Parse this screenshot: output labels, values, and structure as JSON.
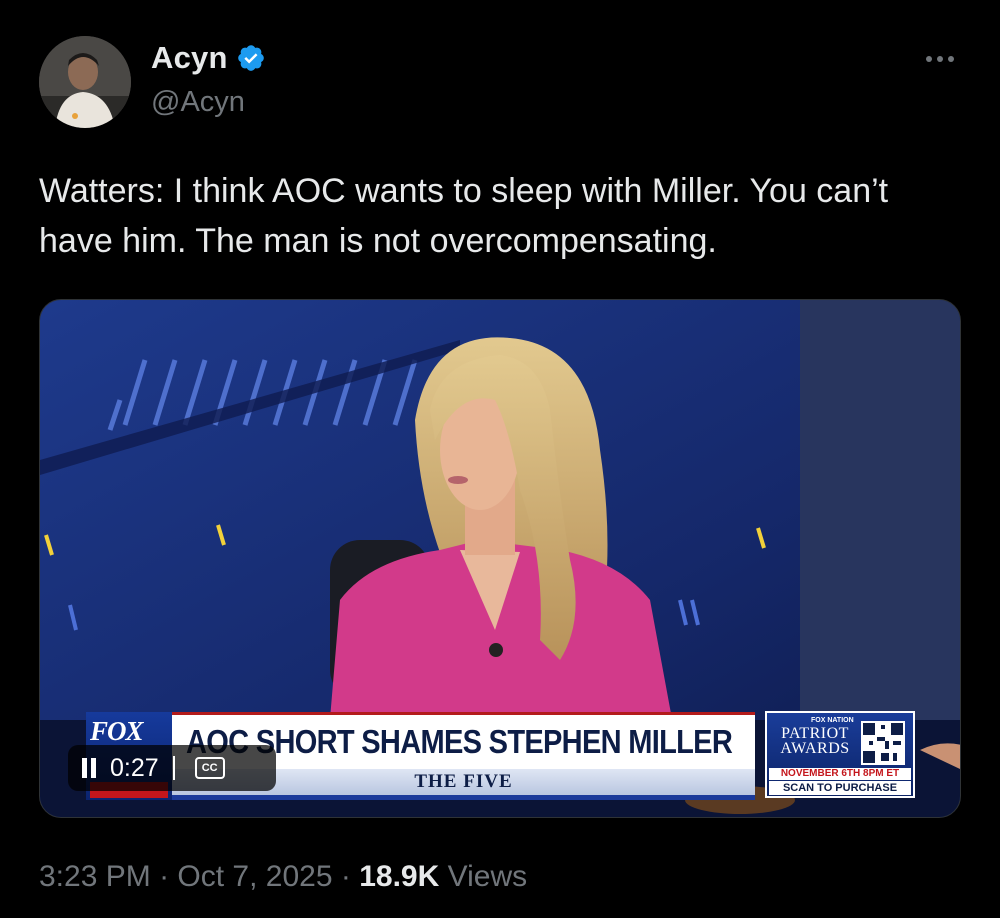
{
  "author": {
    "display_name": "Acyn",
    "handle": "@Acyn",
    "verified": true,
    "verified_badge_color": "#1d9bf0"
  },
  "tweet": {
    "text": "Watters: I think AOC wants to sleep with Miller. You can’t have him. The man is not overcompensating."
  },
  "video": {
    "chyron_headline": "AOC SHORT SHAMES STEPHEN MILLER",
    "show_name": "THE FIVE",
    "network_logo": "FOX",
    "promo": {
      "network": "FOX NATION",
      "title": "PATRIOT AWARDS",
      "date": "NOVEMBER 6TH 8PM ET",
      "cta": "SCAN TO PURCHASE"
    },
    "player": {
      "time": "0:27",
      "captions_label": "CC"
    }
  },
  "meta": {
    "time": "3:23 PM",
    "date": "Oct 7, 2025",
    "views_count": "18.9K",
    "views_label": "Views",
    "separator": "·"
  },
  "icons": {
    "more": "more-horizontal-icon",
    "verified": "verified-badge-icon",
    "pause": "pause-icon",
    "captions": "closed-captions-icon"
  },
  "colors": {
    "background": "#000000",
    "text_primary": "#e7e9ea",
    "text_secondary": "#71767b",
    "fox_red": "#c4161c",
    "fox_navy": "#0d1d46",
    "anchor_outfit": "#d23a8a"
  }
}
